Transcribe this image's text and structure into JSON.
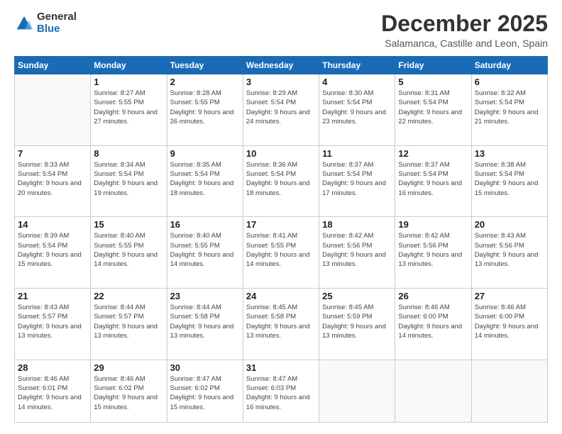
{
  "logo": {
    "general": "General",
    "blue": "Blue"
  },
  "header": {
    "month": "December 2025",
    "location": "Salamanca, Castille and Leon, Spain"
  },
  "weekdays": [
    "Sunday",
    "Monday",
    "Tuesday",
    "Wednesday",
    "Thursday",
    "Friday",
    "Saturday"
  ],
  "weeks": [
    [
      {
        "day": "",
        "empty": true
      },
      {
        "day": "1",
        "sunrise": "Sunrise: 8:27 AM",
        "sunset": "Sunset: 5:55 PM",
        "daylight": "Daylight: 9 hours and 27 minutes."
      },
      {
        "day": "2",
        "sunrise": "Sunrise: 8:28 AM",
        "sunset": "Sunset: 5:55 PM",
        "daylight": "Daylight: 9 hours and 26 minutes."
      },
      {
        "day": "3",
        "sunrise": "Sunrise: 8:29 AM",
        "sunset": "Sunset: 5:54 PM",
        "daylight": "Daylight: 9 hours and 24 minutes."
      },
      {
        "day": "4",
        "sunrise": "Sunrise: 8:30 AM",
        "sunset": "Sunset: 5:54 PM",
        "daylight": "Daylight: 9 hours and 23 minutes."
      },
      {
        "day": "5",
        "sunrise": "Sunrise: 8:31 AM",
        "sunset": "Sunset: 5:54 PM",
        "daylight": "Daylight: 9 hours and 22 minutes."
      },
      {
        "day": "6",
        "sunrise": "Sunrise: 8:32 AM",
        "sunset": "Sunset: 5:54 PM",
        "daylight": "Daylight: 9 hours and 21 minutes."
      }
    ],
    [
      {
        "day": "7",
        "sunrise": "Sunrise: 8:33 AM",
        "sunset": "Sunset: 5:54 PM",
        "daylight": "Daylight: 9 hours and 20 minutes."
      },
      {
        "day": "8",
        "sunrise": "Sunrise: 8:34 AM",
        "sunset": "Sunset: 5:54 PM",
        "daylight": "Daylight: 9 hours and 19 minutes."
      },
      {
        "day": "9",
        "sunrise": "Sunrise: 8:35 AM",
        "sunset": "Sunset: 5:54 PM",
        "daylight": "Daylight: 9 hours and 18 minutes."
      },
      {
        "day": "10",
        "sunrise": "Sunrise: 8:36 AM",
        "sunset": "Sunset: 5:54 PM",
        "daylight": "Daylight: 9 hours and 18 minutes."
      },
      {
        "day": "11",
        "sunrise": "Sunrise: 8:37 AM",
        "sunset": "Sunset: 5:54 PM",
        "daylight": "Daylight: 9 hours and 17 minutes."
      },
      {
        "day": "12",
        "sunrise": "Sunrise: 8:37 AM",
        "sunset": "Sunset: 5:54 PM",
        "daylight": "Daylight: 9 hours and 16 minutes."
      },
      {
        "day": "13",
        "sunrise": "Sunrise: 8:38 AM",
        "sunset": "Sunset: 5:54 PM",
        "daylight": "Daylight: 9 hours and 15 minutes."
      }
    ],
    [
      {
        "day": "14",
        "sunrise": "Sunrise: 8:39 AM",
        "sunset": "Sunset: 5:54 PM",
        "daylight": "Daylight: 9 hours and 15 minutes."
      },
      {
        "day": "15",
        "sunrise": "Sunrise: 8:40 AM",
        "sunset": "Sunset: 5:55 PM",
        "daylight": "Daylight: 9 hours and 14 minutes."
      },
      {
        "day": "16",
        "sunrise": "Sunrise: 8:40 AM",
        "sunset": "Sunset: 5:55 PM",
        "daylight": "Daylight: 9 hours and 14 minutes."
      },
      {
        "day": "17",
        "sunrise": "Sunrise: 8:41 AM",
        "sunset": "Sunset: 5:55 PM",
        "daylight": "Daylight: 9 hours and 14 minutes."
      },
      {
        "day": "18",
        "sunrise": "Sunrise: 8:42 AM",
        "sunset": "Sunset: 5:56 PM",
        "daylight": "Daylight: 9 hours and 13 minutes."
      },
      {
        "day": "19",
        "sunrise": "Sunrise: 8:42 AM",
        "sunset": "Sunset: 5:56 PM",
        "daylight": "Daylight: 9 hours and 13 minutes."
      },
      {
        "day": "20",
        "sunrise": "Sunrise: 8:43 AM",
        "sunset": "Sunset: 5:56 PM",
        "daylight": "Daylight: 9 hours and 13 minutes."
      }
    ],
    [
      {
        "day": "21",
        "sunrise": "Sunrise: 8:43 AM",
        "sunset": "Sunset: 5:57 PM",
        "daylight": "Daylight: 9 hours and 13 minutes."
      },
      {
        "day": "22",
        "sunrise": "Sunrise: 8:44 AM",
        "sunset": "Sunset: 5:57 PM",
        "daylight": "Daylight: 9 hours and 13 minutes."
      },
      {
        "day": "23",
        "sunrise": "Sunrise: 8:44 AM",
        "sunset": "Sunset: 5:58 PM",
        "daylight": "Daylight: 9 hours and 13 minutes."
      },
      {
        "day": "24",
        "sunrise": "Sunrise: 8:45 AM",
        "sunset": "Sunset: 5:58 PM",
        "daylight": "Daylight: 9 hours and 13 minutes."
      },
      {
        "day": "25",
        "sunrise": "Sunrise: 8:45 AM",
        "sunset": "Sunset: 5:59 PM",
        "daylight": "Daylight: 9 hours and 13 minutes."
      },
      {
        "day": "26",
        "sunrise": "Sunrise: 8:46 AM",
        "sunset": "Sunset: 6:00 PM",
        "daylight": "Daylight: 9 hours and 14 minutes."
      },
      {
        "day": "27",
        "sunrise": "Sunrise: 8:46 AM",
        "sunset": "Sunset: 6:00 PM",
        "daylight": "Daylight: 9 hours and 14 minutes."
      }
    ],
    [
      {
        "day": "28",
        "sunrise": "Sunrise: 8:46 AM",
        "sunset": "Sunset: 6:01 PM",
        "daylight": "Daylight: 9 hours and 14 minutes."
      },
      {
        "day": "29",
        "sunrise": "Sunrise: 8:46 AM",
        "sunset": "Sunset: 6:02 PM",
        "daylight": "Daylight: 9 hours and 15 minutes."
      },
      {
        "day": "30",
        "sunrise": "Sunrise: 8:47 AM",
        "sunset": "Sunset: 6:02 PM",
        "daylight": "Daylight: 9 hours and 15 minutes."
      },
      {
        "day": "31",
        "sunrise": "Sunrise: 8:47 AM",
        "sunset": "Sunset: 6:03 PM",
        "daylight": "Daylight: 9 hours and 16 minutes."
      },
      {
        "day": "",
        "empty": true
      },
      {
        "day": "",
        "empty": true
      },
      {
        "day": "",
        "empty": true
      }
    ]
  ]
}
